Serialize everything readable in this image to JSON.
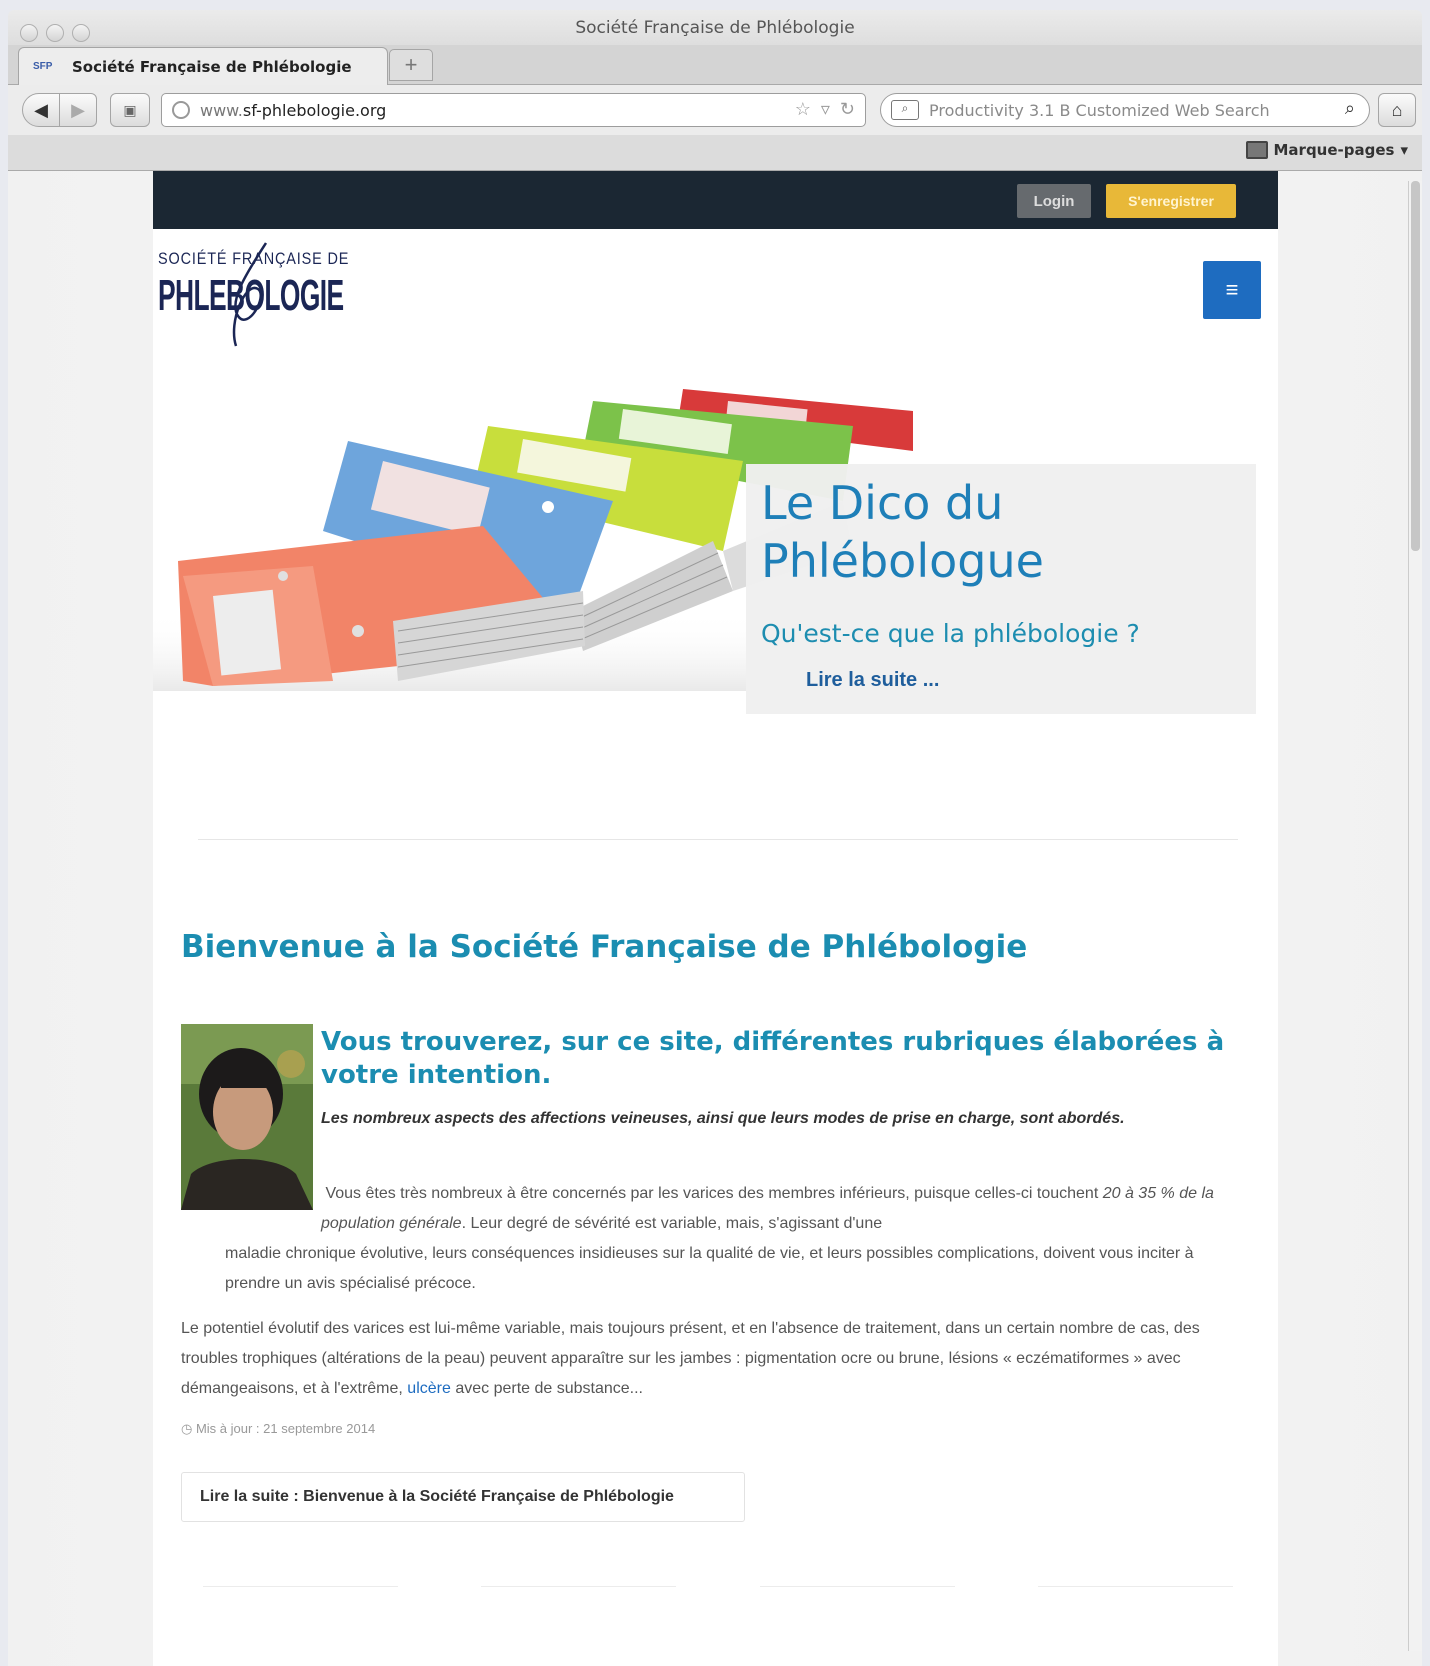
{
  "window": {
    "title": "Société Française de Phlébologie"
  },
  "tabs": [
    {
      "favicon": "SFP",
      "label": "Société Française de Phlébologie"
    }
  ],
  "new_tab_label": "+",
  "toolbar": {
    "url_prefix": "www.",
    "url_host": "sf-phlebologie.org",
    "search_placeholder": "Productivity 3.1 B Customized Web Search",
    "bookmarks_label": "Marque-pages"
  },
  "site": {
    "login_label": "Login",
    "register_label": "S'enregistrer",
    "logo_line1": "SOCIÉTÉ FRANÇAISE DE",
    "logo_line2": "PHLEBOLOGIE",
    "menu_icon": "≡",
    "hero": {
      "title": "Le Dico du Phlébologue",
      "subtitle": "Qu'est-ce que la phlébologie ?",
      "more": "Lire la suite ..."
    },
    "welcome_title": "Bienvenue à la Société Française de Phlébologie",
    "article": {
      "heading": "Vous trouverez, sur ce site, différentes rubriques élaborées à votre intention.",
      "lead": "Les nombreux aspects des affections veineuses, ainsi que leurs modes de prise en charge, sont abordés.",
      "para1_a": "Vous êtes très nombreux à être concernés par les varices des membres inférieurs, puisque celles-ci touchent ",
      "para1_em": "20 à 35 % de la population générale",
      "para1_b": ". Leur degré de sévérité est variable, mais, s'agissant d'une",
      "para1_cont": "maladie chronique évolutive, leurs conséquences insidieuses sur la qualité de vie, et leurs possibles complications, doivent vous inciter à prendre un avis spécialisé précoce.",
      "para2_a": "Le potentiel évolutif des varices est lui-même variable, mais toujours présent, et en l'absence de traitement, dans un certain nombre de cas, des troubles trophiques (altérations de la peau) peuvent apparaître sur les jambes : pigmentation ocre ou brune, lésions « eczématiformes » avec démangeaisons, et à l'extrême, ",
      "para2_link": "ulcère",
      "para2_b": " avec perte de substance...",
      "updated": "Mis à jour : 21 septembre 2014",
      "readmore": "Lire la suite : Bienvenue à la Société Française de Phlébologie"
    }
  }
}
